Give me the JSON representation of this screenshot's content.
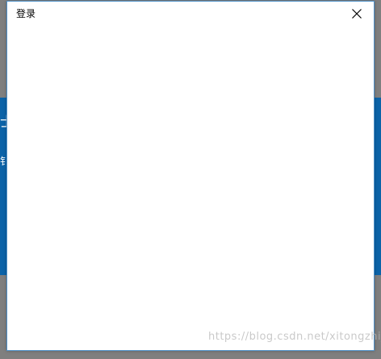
{
  "background": {
    "band_color": "#0b63a8",
    "peek_title": "士",
    "peek_subtitle": "钅"
  },
  "dialog": {
    "title": "登录",
    "close_icon": "close-icon",
    "border_color": "#4d8fc7"
  },
  "watermark": {
    "text": "https://blog.csdn.net/xitongzhijia"
  }
}
